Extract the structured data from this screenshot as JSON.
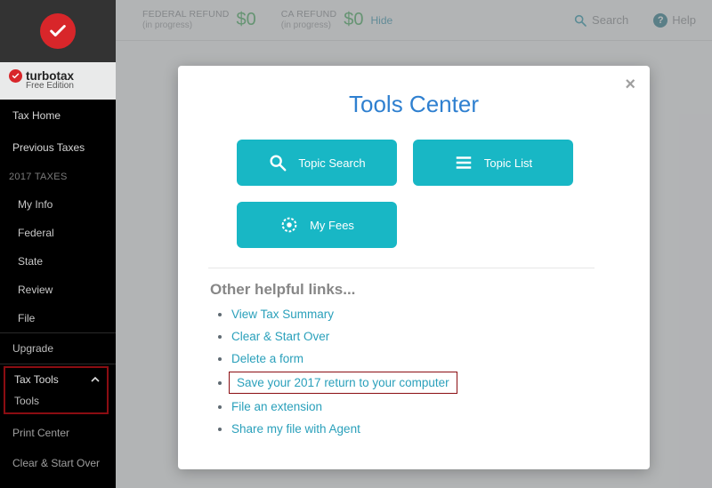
{
  "brand": {
    "name": "turbotax",
    "sub": "Free Edition"
  },
  "sidebar": {
    "tax_home": "Tax Home",
    "previous": "Previous Taxes",
    "section": "2017 TAXES",
    "items": [
      "My Info",
      "Federal",
      "State",
      "Review",
      "File"
    ],
    "upgrade": "Upgrade",
    "tax_tools": "Tax Tools",
    "tools": "Tools",
    "print_center": "Print Center",
    "clear": "Clear & Start Over"
  },
  "topbar": {
    "fed_label": "FEDERAL REFUND",
    "ip": "(in progress)",
    "ca_label": "CA REFUND",
    "fed_amount": "$0",
    "ca_amount": "$0",
    "hide": "Hide",
    "search": "Search",
    "help": "Help"
  },
  "modal": {
    "title": "Tools Center",
    "btn_topic_search": "Topic Search",
    "btn_topic_list": "Topic List",
    "btn_my_fees": "My Fees",
    "other_head": "Other helpful links...",
    "links": {
      "summary": "View Tax Summary",
      "clear": "Clear & Start Over",
      "delete": "Delete a form",
      "save": "Save your 2017 return to your computer",
      "ext": "File an extension",
      "share": "Share my file with Agent"
    }
  }
}
